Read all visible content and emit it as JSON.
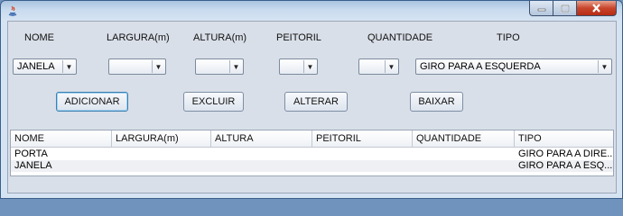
{
  "labels": {
    "nome": "NOME",
    "largura": "LARGURA(m)",
    "altura": "ALTURA(m)",
    "peitoril": "PEITORIL",
    "quantidade": "QUANTIDADE",
    "tipo": "TIPO"
  },
  "combos": {
    "nome": "JANELA",
    "largura": "",
    "altura": "",
    "peitoril": "",
    "quantidade": "",
    "tipo": "GIRO PARA A ESQUERDA"
  },
  "buttons": {
    "adicionar": "ADICIONAR",
    "excluir": "EXCLUIR",
    "alterar": "ALTERAR",
    "baixar": "BAIXAR"
  },
  "table": {
    "columns": [
      "NOME",
      "LARGURA(m)",
      "ALTURA",
      "PEITORIL",
      "QUANTIDADE",
      "TIPO"
    ],
    "rows": [
      [
        "PORTA",
        "",
        "",
        "",
        "",
        "GIRO PARA A DIRE..."
      ],
      [
        "JANELA",
        "",
        "",
        "",
        "",
        "GIRO PARA A ESQ..."
      ]
    ]
  },
  "icons": {
    "app": "java-app-icon",
    "minimize": "minimize-icon",
    "maximize": "maximize-icon",
    "close": "close-icon",
    "dropdown": "chevron-down-icon"
  },
  "colors": {
    "close_button": "#c8452b",
    "focus_border": "#3c7fb1"
  }
}
